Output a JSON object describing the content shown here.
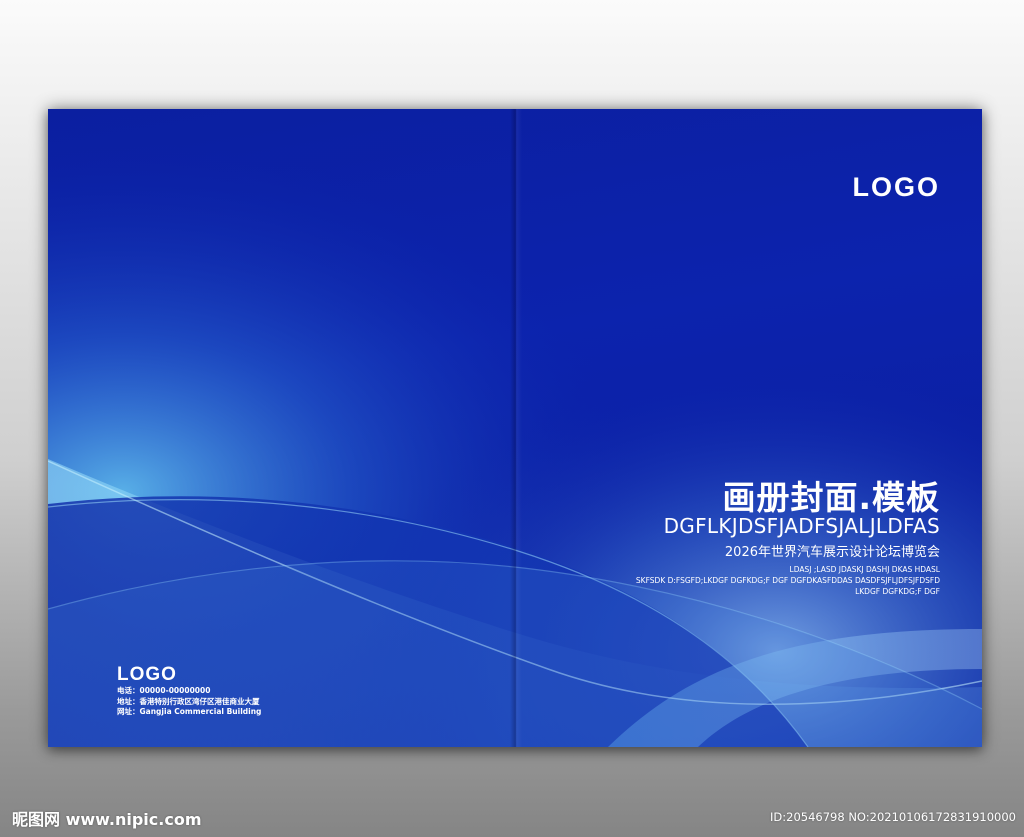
{
  "cover": {
    "logo_right": "LOGO",
    "title_cn": "画册封面.模板",
    "title_en": "DGFLKJDSFJADFSJALJLDFAS",
    "subtitle_cn": "2026年世界汽车展示设计论坛博览会",
    "small_text": [
      "LDASJ ;LASD JDASKJ DASHJ DKAS HDASL",
      "SKFSDK D:FSGFD;LKDGF DGFKDG;F  DGF DGFDKASFDDAS DASDFSJFLJDFSJFDSFD",
      "LKDGF DGFKDG;F  DGF"
    ],
    "logo_left": "LOGO",
    "contact": {
      "phone": "电话：00000-00000000",
      "address": "地址：香港特别行政区湾仔区港佳商业大厦",
      "website": "网址：Gangjia Commercial Building"
    }
  },
  "footer": {
    "site": "昵图网 www.nipic.com",
    "id_text": "ID:20546798 NO:20210106172831910000"
  },
  "colors": {
    "cover_blue": "#0a20a6",
    "wave_light": "#8fe0ff"
  }
}
